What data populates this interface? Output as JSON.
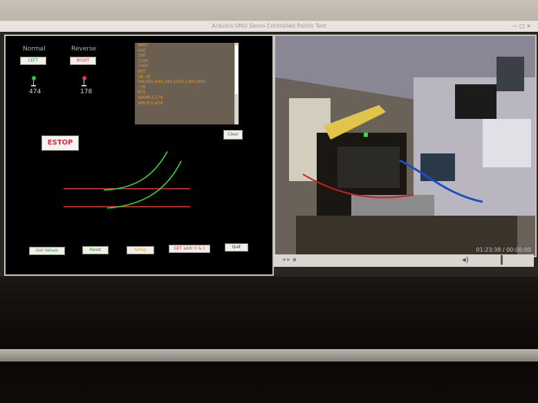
{
  "window": {
    "title": "Arduino UNO Servo Controlled Points Test",
    "controls": "— □ ×"
  },
  "turnout": {
    "normal_label": "Normal",
    "reverse_label": "Reverse",
    "left_button": "LEFT",
    "right_button": "RIGHT",
    "left_value": "474",
    "right_value": "178",
    "left_led_color": "#1fcf3a",
    "right_led_color": "#e23a3a"
  },
  "log": {
    "lines": [
      "WAIT",
      "440",
      "190",
      "1200",
      "1400",
      "800",
      "OK UP",
      "VALUES:440,190,1200,1400,800",
      "178",
      "831",
      "WRPR:3,178",
      "WRLP:0,474"
    ],
    "clear_button": "Clear"
  },
  "estop_label": "ESTOP",
  "estop_color": "#e5283a",
  "buttons": {
    "get_values": "Get Values",
    "reset": "Reset",
    "setup": "Setup",
    "get_addr": "GET addr 0 & 1",
    "quit": "Quit"
  },
  "video": {
    "timecode": "01:23:38 / 00:00:00"
  }
}
